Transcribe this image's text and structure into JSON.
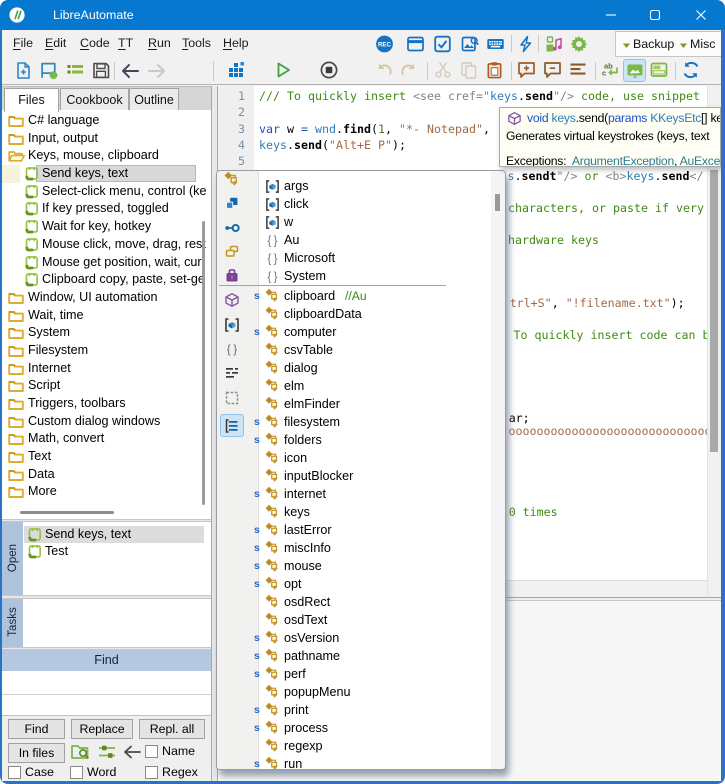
{
  "window": {
    "title": "LibreAutomate",
    "controls": {
      "minimize": "minimize",
      "maximize": "maximize",
      "close": "close"
    }
  },
  "menubar": {
    "items": [
      {
        "label": "File",
        "mnemonic": "F",
        "rest": "ile"
      },
      {
        "label": "Edit",
        "mnemonic": "E",
        "rest": "dit"
      },
      {
        "label": "Code",
        "mnemonic": "C",
        "rest": "ode"
      },
      {
        "label": "TT",
        "mnemonic": "T",
        "rest": "T"
      },
      {
        "label": "Run",
        "mnemonic": "R",
        "rest": "un"
      },
      {
        "label": "Tools",
        "mnemonic": "T",
        "rest": "ools"
      },
      {
        "label": "Help",
        "mnemonic": "H",
        "rest": "elp"
      }
    ],
    "icons": [
      "record",
      "window",
      "checkbox-dialog",
      "image-search",
      "keyboard",
      "hotkey-lightning",
      "icons-colors",
      "options-gear"
    ],
    "backup_label": "Backup",
    "misc_label": "Misc"
  },
  "file_toolbar": {
    "icons": [
      "new-script",
      "properties",
      "outline-list",
      "save",
      "back",
      "forward"
    ]
  },
  "run_toolbar": {
    "icons": [
      "run-setup-grid",
      "run-play",
      "stop",
      "undo",
      "redo",
      "cut",
      "copy",
      "paste",
      "comment-add",
      "comment-remove",
      "format-document",
      "replace-text",
      "screenshot-toggle",
      "panel-layout",
      "sync-refresh"
    ]
  },
  "files_panel": {
    "tabs": [
      "Files",
      "Cookbook",
      "Outline"
    ],
    "active_tab": "Files",
    "tree": [
      {
        "label": "C# language",
        "kind": "folder",
        "indent": 0
      },
      {
        "label": "Input, output",
        "kind": "folder",
        "indent": 0
      },
      {
        "label": "Keys, mouse, clipboard",
        "kind": "folder-open",
        "indent": 0
      },
      {
        "label": "Send keys, text",
        "kind": "recipe",
        "indent": 1,
        "selected": true,
        "current": true
      },
      {
        "label": "Select-click menu, control (ke",
        "kind": "recipe",
        "indent": 1
      },
      {
        "label": "If key pressed, toggled",
        "kind": "recipe",
        "indent": 1
      },
      {
        "label": "Wait for key, hotkey",
        "kind": "recipe",
        "indent": 1
      },
      {
        "label": "Mouse click, move, drag, rest",
        "kind": "recipe",
        "indent": 1
      },
      {
        "label": "Mouse get position, wait, cur",
        "kind": "recipe",
        "indent": 1
      },
      {
        "label": "Clipboard copy, paste, set-ge",
        "kind": "recipe",
        "indent": 1
      },
      {
        "label": "Window, UI automation",
        "kind": "folder",
        "indent": 0
      },
      {
        "label": "Wait, time",
        "kind": "folder",
        "indent": 0
      },
      {
        "label": "System",
        "kind": "folder",
        "indent": 0
      },
      {
        "label": "Filesystem",
        "kind": "folder",
        "indent": 0
      },
      {
        "label": "Internet",
        "kind": "folder",
        "indent": 0
      },
      {
        "label": "Script",
        "kind": "folder",
        "indent": 0
      },
      {
        "label": "Triggers, toolbars",
        "kind": "folder",
        "indent": 0
      },
      {
        "label": "Custom dialog windows",
        "kind": "folder",
        "indent": 0
      },
      {
        "label": "Math, convert",
        "kind": "folder",
        "indent": 0
      },
      {
        "label": "Text",
        "kind": "folder",
        "indent": 0
      },
      {
        "label": "Data",
        "kind": "folder",
        "indent": 0
      },
      {
        "label": "More",
        "kind": "folder",
        "indent": 0
      }
    ]
  },
  "open_panel": {
    "caption": "Open",
    "items": [
      {
        "label": "Send keys, text",
        "selected": true
      },
      {
        "label": "Test",
        "selected": false
      }
    ]
  },
  "tasks_panel": {
    "caption": "Tasks"
  },
  "find_panel": {
    "caption": "Find",
    "find_input_value": "",
    "replace_input_value": "",
    "buttons": {
      "find": "Find",
      "replace": "Replace",
      "replace_all": "Repl. all",
      "in_files": "In files"
    },
    "icons": [
      "search-folder",
      "filter-sliders",
      "arrow-left"
    ],
    "checkboxes": {
      "name": "Name",
      "case": "Case",
      "word": "Word",
      "regex": "Regex"
    }
  },
  "editor": {
    "line_numbers": [
      "1",
      "2",
      "3",
      "4",
      "5"
    ],
    "lines": [
      {
        "tokens": [
          {
            "s": "comment",
            "t": "/// To quickly insert "
          },
          {
            "s": "xml",
            "t": "<see cref=\""
          },
          {
            "s": "type",
            "t": "keys"
          },
          {
            "s": "plain",
            "t": "."
          },
          {
            "s": "func",
            "t": "send"
          },
          {
            "s": "xml",
            "t": "\"/> "
          },
          {
            "s": "comment",
            "t": "code, use snippet"
          }
        ]
      },
      {
        "tokens": []
      },
      {
        "tokens": [
          {
            "s": "keyword",
            "t": "var"
          },
          {
            "s": "plain",
            "t": " w "
          },
          {
            "s": "operator",
            "t": "="
          },
          {
            "s": "plain",
            "t": " "
          },
          {
            "s": "type",
            "t": "wnd"
          },
          {
            "s": "plain",
            "t": "."
          },
          {
            "s": "func",
            "t": "find"
          },
          {
            "s": "plain",
            "t": "("
          },
          {
            "s": "number",
            "t": "1"
          },
          {
            "s": "plain",
            "t": ", "
          },
          {
            "s": "string",
            "t": "\"*- Notepad\""
          },
          {
            "s": "plain",
            "t": ","
          }
        ]
      },
      {
        "tokens": [
          {
            "s": "type",
            "t": "keys"
          },
          {
            "s": "plain",
            "t": "."
          },
          {
            "s": "func",
            "t": "send"
          },
          {
            "s": "plain",
            "t": "("
          },
          {
            "s": "string",
            "t": "\"Alt+E P\""
          },
          {
            "s": "plain",
            "t": ");"
          }
        ]
      },
      {
        "tokens": []
      }
    ],
    "fragments": [
      {
        "tokens": [
          {
            "s": "type",
            "t": "s"
          },
          {
            "s": "plain",
            "t": "."
          },
          {
            "s": "func",
            "t": "sendt"
          },
          {
            "s": "xml",
            "t": "\"/>"
          },
          {
            "s": "comment",
            "t": " or "
          },
          {
            "s": "xml",
            "t": "<b>"
          },
          {
            "s": "type",
            "t": "keys"
          },
          {
            "s": "plain",
            "t": "."
          },
          {
            "s": "func",
            "t": "send"
          },
          {
            "s": "xml",
            "t": "</"
          }
        ]
      },
      {
        "tokens": [
          {
            "s": "comment",
            "t": "characters, or paste if very"
          }
        ]
      },
      {
        "tokens": [
          {
            "s": "comment",
            "t": "hardware keys"
          }
        ]
      },
      {
        "tokens": [
          {
            "s": "string",
            "t": "trl+S\""
          },
          {
            "s": "plain",
            "t": ", "
          },
          {
            "s": "string",
            "t": "\"!filename.txt\""
          },
          {
            "s": "plain",
            "t": ");"
          }
        ]
      },
      {
        "tokens": [
          {
            "s": "comment",
            "t": "To quickly insert code can b"
          }
        ]
      },
      {
        "tokens": [
          {
            "s": "plain",
            "t": "ar;"
          }
        ]
      },
      {
        "tokens": [
          {
            "s": "string",
            "t": "ooooooooooooooooooooooooooooo"
          }
        ]
      },
      {
        "tokens": [
          {
            "s": "comment",
            "t": "0 times"
          }
        ]
      }
    ]
  },
  "tooltip": {
    "signature_tokens": [
      {
        "s": "keyword",
        "t": "void "
      },
      {
        "s": "type",
        "t": "keys"
      },
      {
        "s": "plain",
        "t": ".send("
      },
      {
        "s": "keyword",
        "t": "params"
      },
      {
        "s": "type",
        "t": " KKeysEtc"
      },
      {
        "s": "plain",
        "t": "[] ke"
      }
    ],
    "description": "Generates virtual keystrokes (keys, text",
    "exceptions_label": "Exceptions:",
    "exception_link1": "ArgumentException",
    "separator": ", ",
    "exception_link2": "AuExce"
  },
  "completion": {
    "filter_icons": [
      "class",
      "struct",
      "enum",
      "interface",
      "module",
      "namespace-cube",
      "local",
      "braces",
      "keyword-list",
      "snippet",
      "group-toggle"
    ],
    "static_prefix": "s",
    "top_items": [
      {
        "label": "args",
        "kind": "local"
      },
      {
        "label": "click",
        "kind": "local"
      },
      {
        "label": "w",
        "kind": "local"
      },
      {
        "label": "Au",
        "kind": "namespace"
      },
      {
        "label": "Microsoft",
        "kind": "namespace"
      },
      {
        "label": "System",
        "kind": "namespace"
      }
    ],
    "items": [
      {
        "label": "clipboard",
        "static": true,
        "comment": "//Au"
      },
      {
        "label": "clipboardData",
        "static": false
      },
      {
        "label": "computer",
        "static": true
      },
      {
        "label": "csvTable",
        "static": false
      },
      {
        "label": "dialog",
        "static": false
      },
      {
        "label": "elm",
        "static": false
      },
      {
        "label": "elmFinder",
        "static": false
      },
      {
        "label": "filesystem",
        "static": true
      },
      {
        "label": "folders",
        "static": true
      },
      {
        "label": "icon",
        "static": false
      },
      {
        "label": "inputBlocker",
        "static": false
      },
      {
        "label": "internet",
        "static": true
      },
      {
        "label": "keys",
        "static": false
      },
      {
        "label": "lastError",
        "static": true
      },
      {
        "label": "miscInfo",
        "static": true
      },
      {
        "label": "mouse",
        "static": true
      },
      {
        "label": "opt",
        "static": true
      },
      {
        "label": "osdRect",
        "static": false
      },
      {
        "label": "osdText",
        "static": false
      },
      {
        "label": "osVersion",
        "static": true
      },
      {
        "label": "pathname",
        "static": true
      },
      {
        "label": "perf",
        "static": true
      },
      {
        "label": "popupMenu",
        "static": false
      },
      {
        "label": "print",
        "static": true
      },
      {
        "label": "process",
        "static": true
      },
      {
        "label": "regexp",
        "static": false
      },
      {
        "label": "run",
        "static": true
      }
    ]
  },
  "colors": {
    "accent_titlebar": "#0778D0",
    "comment_green": "#3F8A10",
    "string_brown": "#A06A48",
    "keyword_blue": "#1B50C8",
    "type_blue": "#2E7CB4",
    "xml_grey": "#848484",
    "link_teal": "#2D7D8E"
  }
}
